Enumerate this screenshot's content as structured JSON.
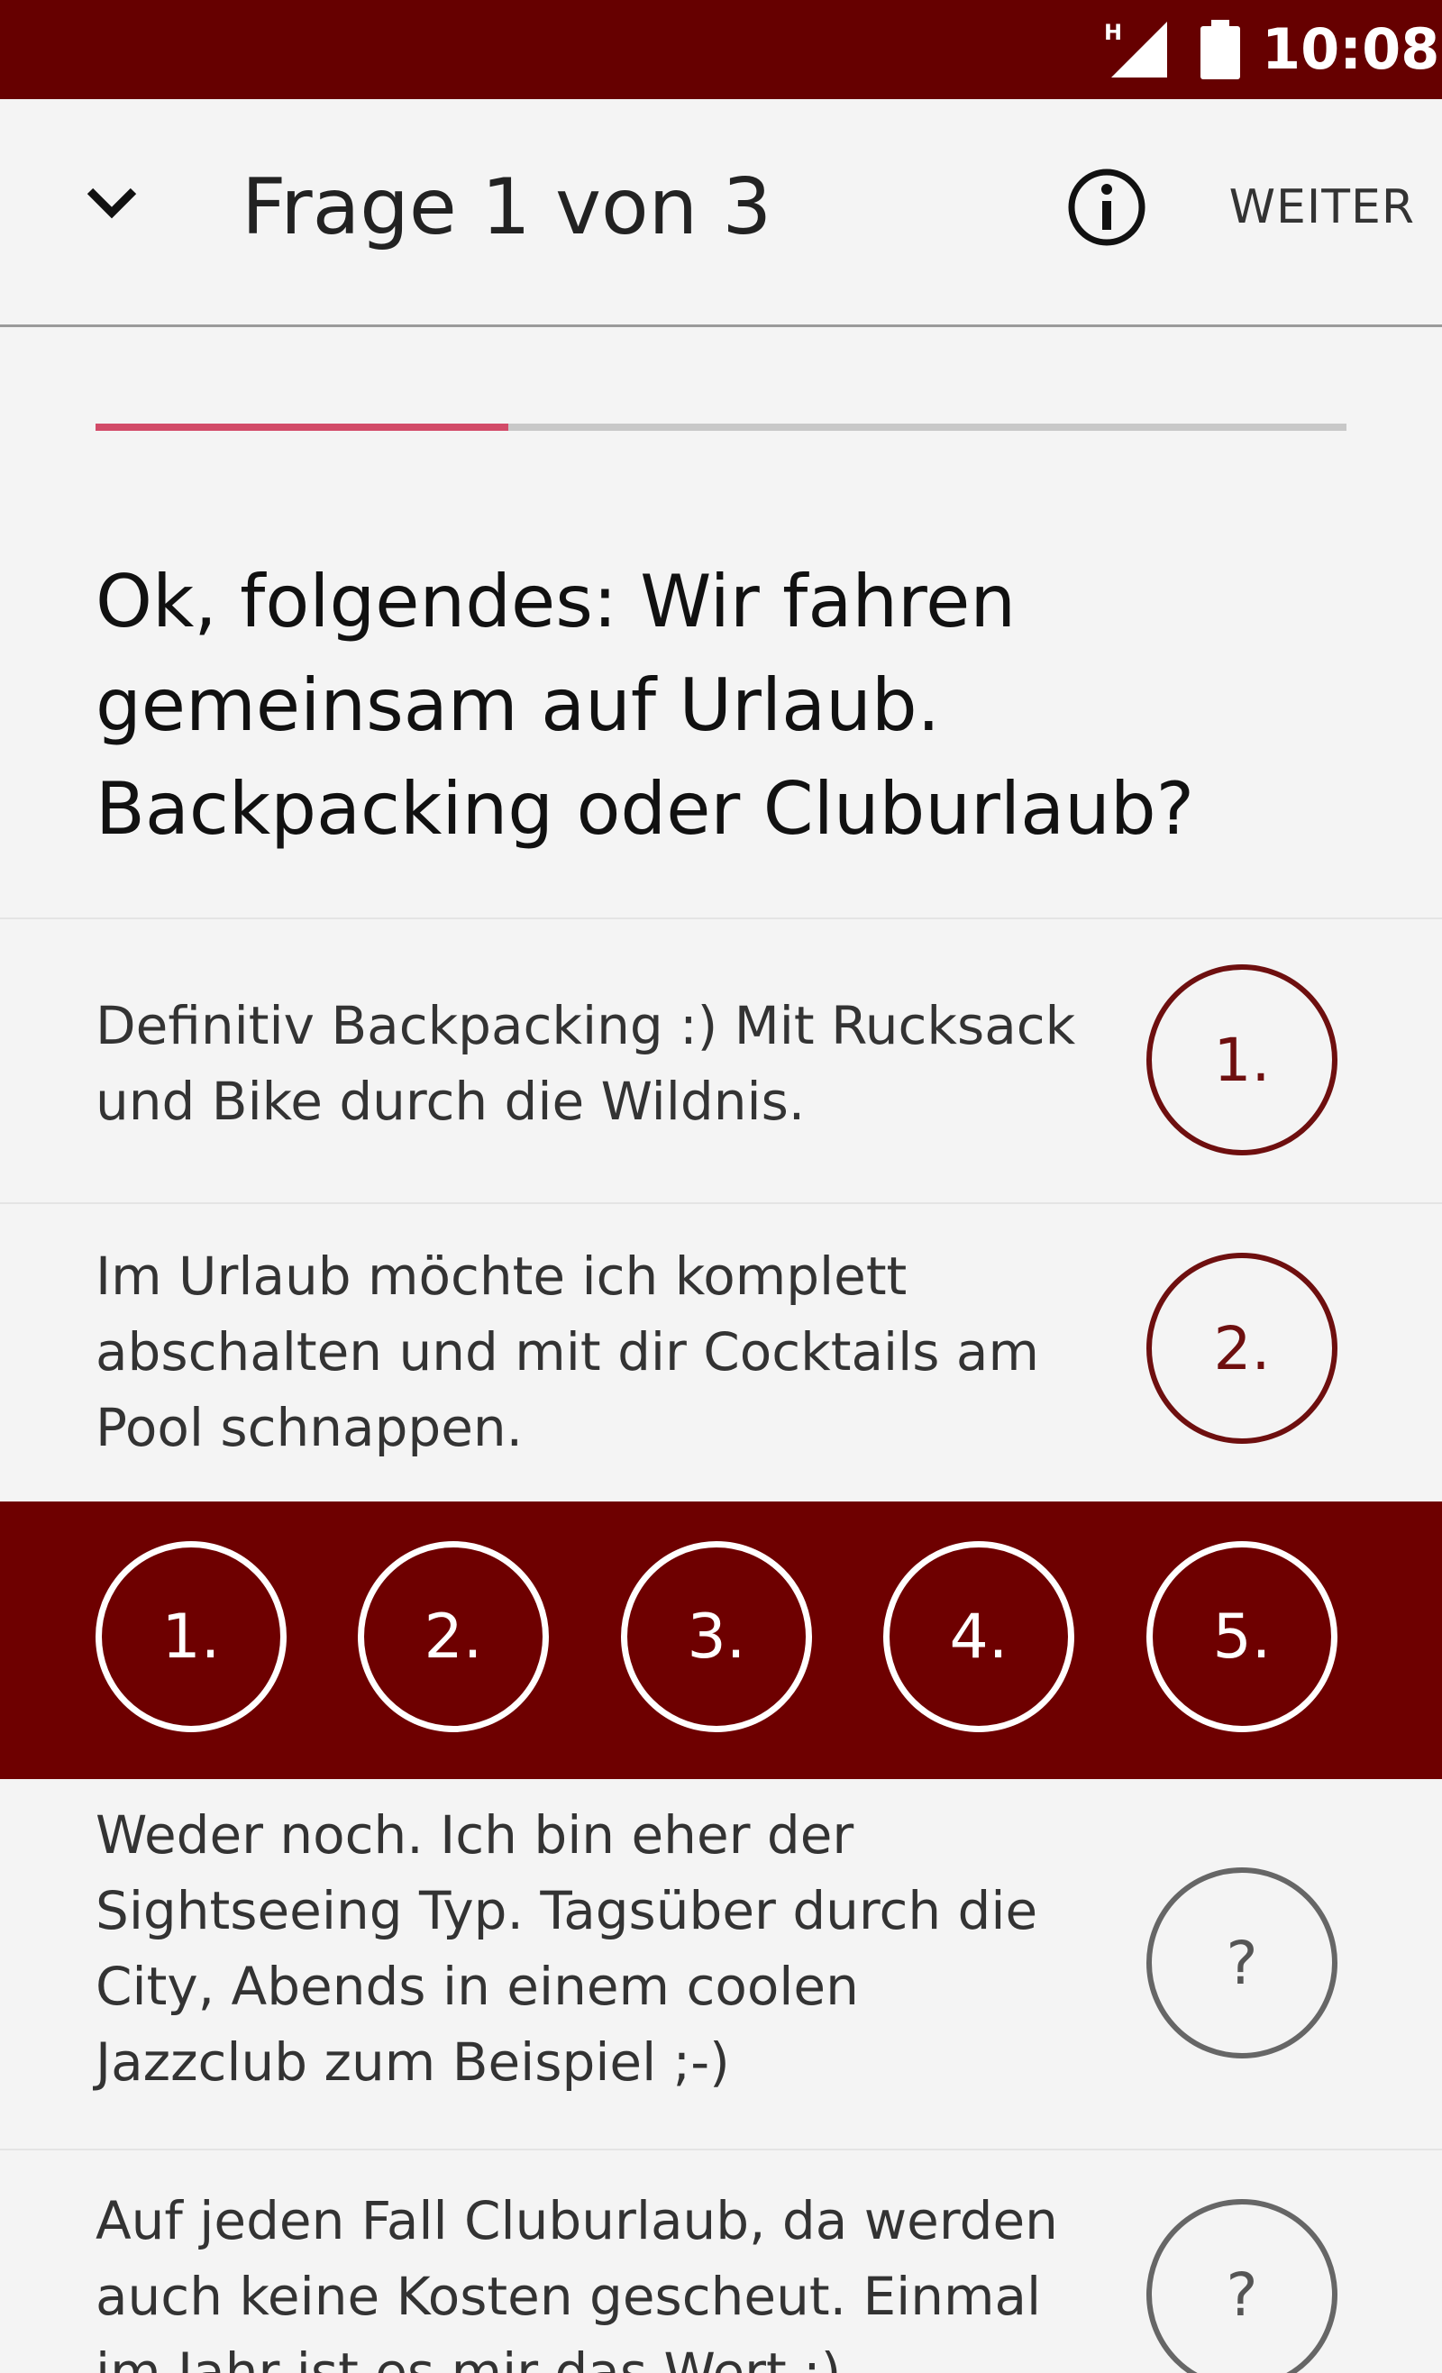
{
  "status_bar": {
    "network": "H",
    "time": "10:08"
  },
  "app_bar": {
    "title": "Frage 1 von 3",
    "next_label": "WEITER"
  },
  "progress": {
    "fraction": 0.33
  },
  "question": "Ok, folgendes: Wir fahren gemeinsam auf Urlaub. Backpacking oder Cluburlaub?",
  "answers": [
    {
      "text": "Definitiv Backpacking :) Mit Rucksack und Bike durch die Wildnis.",
      "rank": "1."
    },
    {
      "text": "Im Urlaub möchte ich komplett abschalten und mit dir Cocktails am Pool schnappen.",
      "rank": "2."
    },
    {
      "text": "Weder noch. Ich bin eher der Sightseeing Typ. Tagsüber durch die City, Abends in einem coolen Jazzclub zum Beispiel ;-)",
      "rank": "?"
    },
    {
      "text": "Auf jeden Fall Cluburlaub, da werden auch keine Kosten gescheut. Einmal im Jahr ist es mir das Wert :)",
      "rank": "?"
    }
  ],
  "rank_options": [
    "1.",
    "2.",
    "3.",
    "4.",
    "5."
  ],
  "colors": {
    "primary": "#660000",
    "accent": "#d24b68",
    "rank_selected": "#6e0f0f",
    "rank_unset": "#666666"
  }
}
